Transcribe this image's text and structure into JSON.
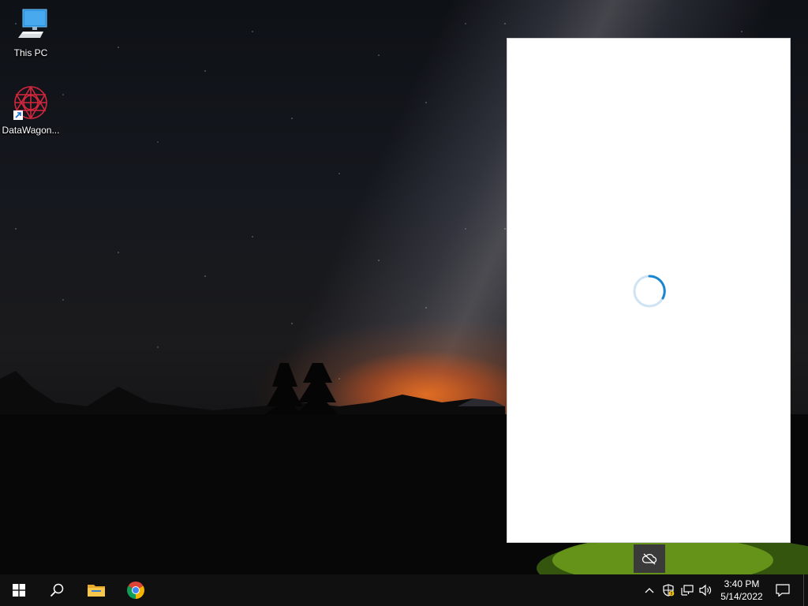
{
  "desktop": {
    "icons": [
      {
        "label": "This PC",
        "icon": "computer-icon"
      },
      {
        "label": "DataWagon...",
        "icon": "datawagon-app-icon"
      }
    ]
  },
  "flyout": {
    "state": "loading",
    "spinner_color": "#1a86d0"
  },
  "taskbar": {
    "start_icon": "windows-logo-icon",
    "search_icon": "search-icon",
    "pinned": [
      {
        "name": "File Explorer",
        "icon": "folder-icon"
      },
      {
        "name": "Google Chrome",
        "icon": "chrome-icon"
      }
    ],
    "tray": {
      "icons": [
        "chevron-up-icon",
        "security-alert-icon",
        "network-icon",
        "volume-icon"
      ],
      "time": "3:40 PM",
      "date": "5/14/2022",
      "notification_icon": "action-center-icon"
    }
  },
  "colors": {
    "taskbar_bg": "#101010",
    "accent": "#1a86d0"
  }
}
